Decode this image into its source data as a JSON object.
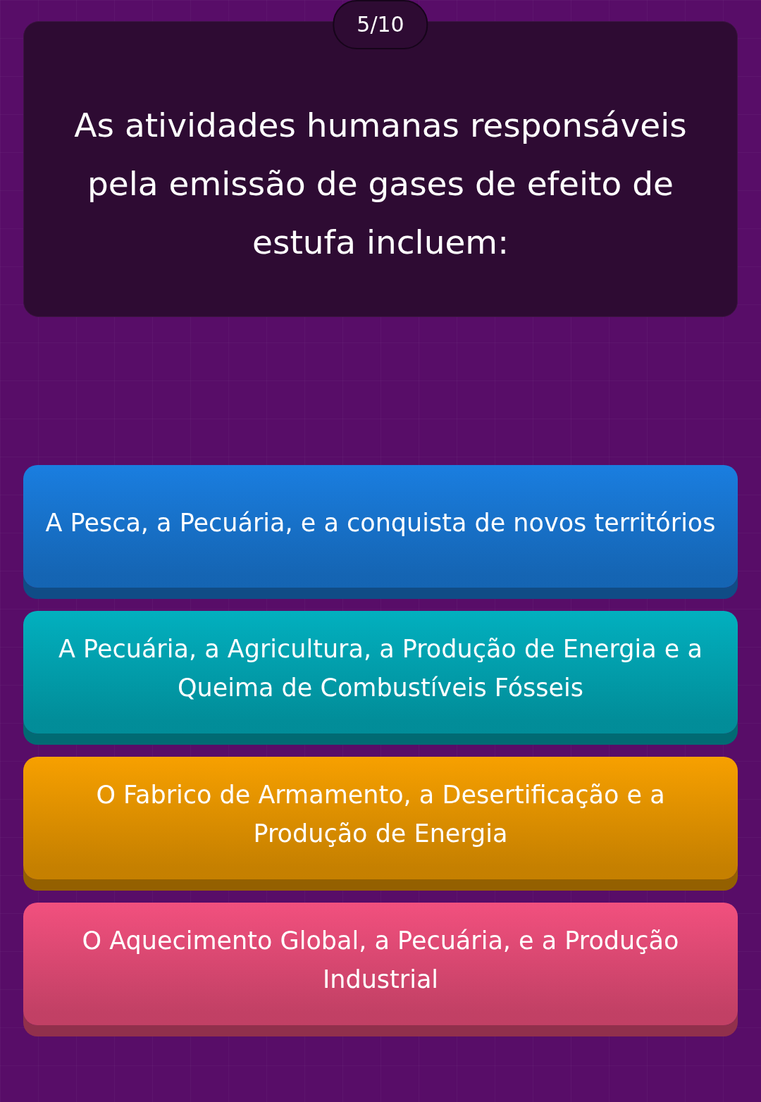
{
  "counter": "5/10",
  "question": "As atividades humanas responsáveis pela emissão de gases de efeito de estufa incluem:",
  "answers": [
    {
      "text": "A Pesca, a Pecuária, e a conquista de novos territórios",
      "color": "#1a7ee0"
    },
    {
      "text": "A Pecuária, a Agricultura, a Produção de Energia e a Queima de Combustíveis Fósseis",
      "color": "#02b0bf"
    },
    {
      "text": "O Fabrico de Armamento, a Desertificação e a Produção de Energia",
      "color": "#f7a000"
    },
    {
      "text": "O Aquecimento Global, a Pecuária, e a Produção Industrial",
      "color": "#f2507e"
    }
  ]
}
